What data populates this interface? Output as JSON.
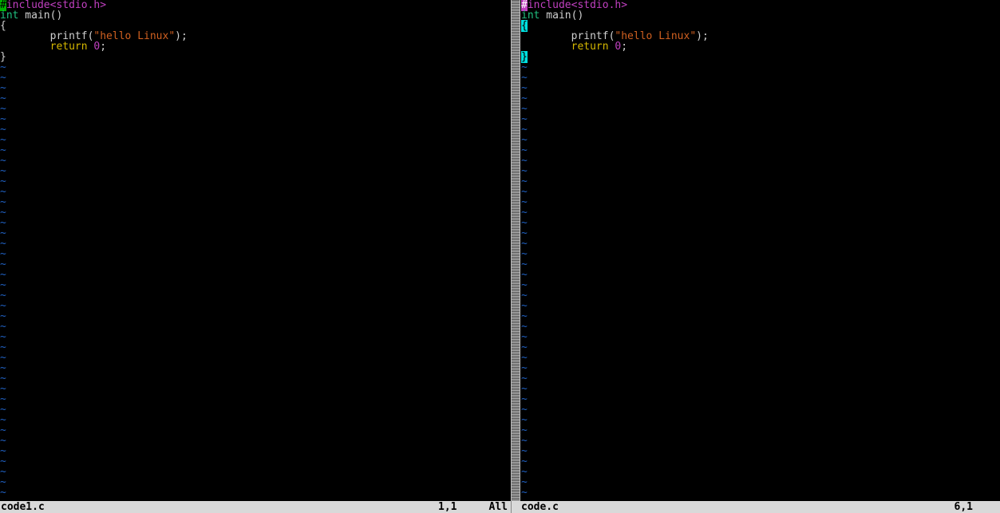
{
  "colors": {
    "bg": "#000000",
    "fg": "#d0d0d0",
    "keyword_type": "#20c080",
    "keyword_return": "#d6b800",
    "preproc": "#c040c0",
    "string": "#d06020",
    "number": "#c040c0",
    "header": "#c040c0",
    "tilde": "#2060c0",
    "cursor_green": "#00b000",
    "cursor_cyan": "#00dede",
    "statusbar_bg": "#d9d9d9",
    "statusbar_fg": "#000000"
  },
  "split": "vertical",
  "left": {
    "filename": "code1.c",
    "cursor_pos": "1,1",
    "percentage": "All",
    "lines": [
      {
        "segments": [
          {
            "t": "#",
            "cls": "crs-green"
          },
          {
            "t": "include",
            "cls": "pre"
          },
          {
            "t": "<stdio.h>",
            "cls": "hdr"
          }
        ]
      },
      {
        "segments": [
          {
            "t": "int",
            "cls": "kw-int"
          },
          {
            "t": " main()",
            "cls": "tx"
          }
        ]
      },
      {
        "segments": [
          {
            "t": "{",
            "cls": "tx"
          }
        ]
      },
      {
        "segments": [
          {
            "t": "        printf(",
            "cls": "tx"
          },
          {
            "t": "\"hello Linux\"",
            "cls": "str"
          },
          {
            "t": ");",
            "cls": "tx"
          }
        ]
      },
      {
        "segments": [
          {
            "t": "        ",
            "cls": "tx"
          },
          {
            "t": "return",
            "cls": "kw-ret"
          },
          {
            "t": " ",
            "cls": "tx"
          },
          {
            "t": "0",
            "cls": "num"
          },
          {
            "t": ";",
            "cls": "tx"
          }
        ]
      },
      {
        "segments": [
          {
            "t": "}",
            "cls": "tx"
          }
        ]
      }
    ],
    "empty_line_marker": "~",
    "empty_rows": 42
  },
  "right": {
    "filename": "code.c",
    "cursor_pos": "6,1",
    "percentage": "",
    "lines": [
      {
        "segments": [
          {
            "t": "#",
            "cls": "hash-hl"
          },
          {
            "t": "include",
            "cls": "pre"
          },
          {
            "t": "<stdio.h>",
            "cls": "hdr"
          }
        ]
      },
      {
        "segments": [
          {
            "t": "int",
            "cls": "kw-int"
          },
          {
            "t": " main()",
            "cls": "tx"
          }
        ]
      },
      {
        "segments": [
          {
            "t": "{",
            "cls": "crs-hl"
          }
        ]
      },
      {
        "segments": [
          {
            "t": "        printf(",
            "cls": "tx"
          },
          {
            "t": "\"hello Linux\"",
            "cls": "str"
          },
          {
            "t": ");",
            "cls": "tx"
          }
        ]
      },
      {
        "segments": [
          {
            "t": "        ",
            "cls": "tx"
          },
          {
            "t": "return",
            "cls": "kw-ret"
          },
          {
            "t": " ",
            "cls": "tx"
          },
          {
            "t": "0",
            "cls": "num"
          },
          {
            "t": ";",
            "cls": "tx"
          }
        ]
      },
      {
        "segments": [
          {
            "t": "}",
            "cls": "crs-hl"
          }
        ]
      }
    ],
    "empty_line_marker": "~",
    "empty_rows": 42
  }
}
